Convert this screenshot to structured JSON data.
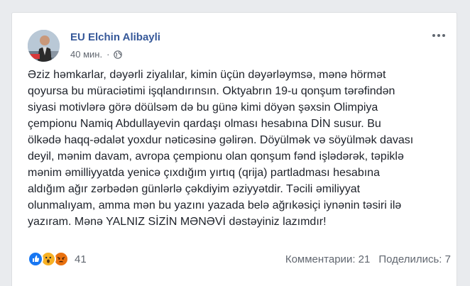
{
  "post": {
    "author": "EU Elchin Alibayli",
    "time": "40 мин.",
    "separator": "·",
    "privacy_icon": "globe-icon",
    "more_icon": "more-options-icon",
    "text_lines": [
      "Əziz həmkarlar, dəyərli ziyalılar, kimin üçün dəyərləymsə, mənə hörmət",
      "qoyursa bu müraciətimi işqlandırınsın. Oktyabrın 19-u qonşum tərəfindən",
      "siyasi motivlərə görə döülsəm də bu günə kimi döyən şəxsin Olimpiya",
      "çempionu Namiq Abdullayevin qardaşı olması hesabına DİN susur. Bu",
      "ölkədə haqq-ədalət yoxdur nəticəsinə gəlirən. Döyülmək və söyülmək davası",
      "deyil, mənim davam, avropa çempionu olan qonşum fənd işlədərək, təpiklə",
      "mənim əmilliyyatda yenicə çıxdığım yırtıq (qrija) partladması hesabına",
      "aldığım ağır zərbədən günlərlə çəkdiyim əziyyətdir. Təcili əmiliyyat",
      "olunmalıyam, amma mən bu yazını yazada belə ağrıkəsiçi iynənin təsiri ilə",
      "yazıram. Mənə YALNIZ SİZİN MƏNƏVİ dəstəyiniz lazımdır!"
    ]
  },
  "reactions": {
    "icons": [
      "like-icon",
      "wow-icon",
      "angry-icon"
    ],
    "count": "41"
  },
  "stats": {
    "comments": "Комментарии: 21",
    "shares": "Поделились: 7"
  },
  "colors": {
    "author_link": "#365899",
    "like": "#1877f2",
    "wow": "#f7b125",
    "angry": "#e9710f"
  }
}
